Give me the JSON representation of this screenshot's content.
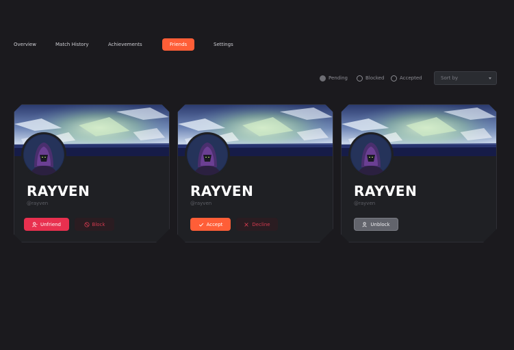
{
  "tabs": {
    "overview": "Overview",
    "match_history": "Match History",
    "achievements": "Achievements",
    "friends": "Friends",
    "settings": "Settings"
  },
  "filters": {
    "pending": "Pending",
    "blocked": "Blocked",
    "accepted": "Accepted",
    "selected": "Pending",
    "sort_placeholder": "Sort by"
  },
  "cards": [
    {
      "name": "RAYVEN",
      "handle": "@rayven",
      "primary_label": "Unfriend",
      "secondary_label": "Block"
    },
    {
      "name": "RAYVEN",
      "handle": "@rayven",
      "primary_label": "Accept",
      "secondary_label": "Decline"
    },
    {
      "name": "RAYVEN",
      "handle": "@rayven",
      "primary_label": "Unblock"
    }
  ],
  "colors": {
    "accent": "#ff5e37",
    "danger": "#e8304f",
    "background": "#1b1a1e",
    "card": "#1f2024"
  },
  "icons": {
    "unfriend": "user-minus-icon",
    "block": "block-icon",
    "accept": "check-icon",
    "decline": "x-icon",
    "unblock": "user-icon"
  }
}
